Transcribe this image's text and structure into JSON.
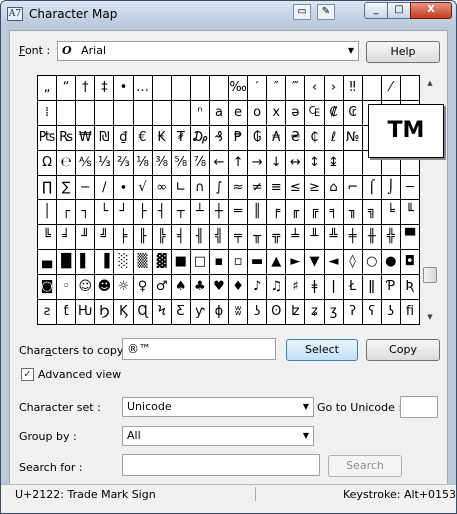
{
  "window": {
    "title": "Character Map",
    "app_icon_text": "A7",
    "icons": [
      "window-icon",
      "eraser-icon"
    ],
    "controls": {
      "minimize": "_",
      "maximize": "□",
      "close": "X"
    }
  },
  "font": {
    "label": "Font :",
    "value": "Arial",
    "icon_glyph": "O",
    "help_label": "Help"
  },
  "grid": {
    "rows": [
      [
        "„",
        "“",
        "†",
        "‡",
        "•",
        "…",
        "",
        "",
        "",
        "",
        "‰",
        "′",
        "″",
        "‴",
        "‹",
        "›",
        "‼",
        "",
        "⁄",
        ""
      ],
      [
        "⁞",
        "",
        "",
        "",
        "",
        "",
        "",
        "",
        "ⁿ",
        "a",
        "e",
        "o",
        "x",
        "ə",
        "₠",
        "₡",
        "₢",
        "₣",
        "₤",
        "₦"
      ],
      [
        "₧",
        "₨",
        "₩",
        "₪",
        "₫",
        "€",
        "₭",
        "₮",
        "₯",
        "₰",
        "₱",
        "₲",
        "₳",
        "₴",
        "₵",
        "ℓ",
        "№",
        "",
        "",
        ""
      ],
      [
        "Ω",
        "℮",
        "⅍",
        "⅓",
        "⅔",
        "⅛",
        "⅜",
        "⅝",
        "⅞",
        "←",
        "↑",
        "→",
        "↓",
        "↔",
        "↕",
        "↨",
        "",
        "",
        "",
        ""
      ],
      [
        "∏",
        "∑",
        "−",
        "∕",
        "∙",
        "√",
        "∞",
        "∟",
        "∩",
        "∫",
        "≈",
        "≠",
        "≡",
        "≤",
        "≥",
        "⌂",
        "⌐",
        "⌠",
        "⌡",
        "─"
      ],
      [
        "│",
        "┌",
        "┐",
        "└",
        "┘",
        "├",
        "┤",
        "┬",
        "┴",
        "┼",
        "═",
        "║",
        "╒",
        "╓",
        "╔",
        "╕",
        "╖",
        "╗",
        "╘",
        "╙"
      ],
      [
        "╚",
        "╛",
        "╜",
        "╝",
        "╞",
        "╟",
        "╠",
        "╡",
        "╢",
        "╣",
        "╤",
        "╥",
        "╦",
        "╧",
        "╨",
        "╩",
        "╪",
        "╫",
        "╬",
        "▀"
      ],
      [
        "▄",
        "█",
        "▌",
        "▐",
        "░",
        "▒",
        "▓",
        "■",
        "□",
        "▪",
        "▫",
        "▬",
        "▲",
        "►",
        "▼",
        "◄",
        "◊",
        "○",
        "●",
        "◘"
      ],
      [
        "◙",
        "◦",
        "☺",
        "☻",
        "☼",
        "♀",
        "♂",
        "♠",
        "♣",
        "♥",
        "♦",
        "♪",
        "♫",
        "♯",
        "ǂ",
        "ǀ",
        "Ł",
        "ǁ",
        "Ƥ",
        "Ʀ"
      ],
      [
        "ƨ",
        "ƭ",
        "Ƕ",
        "Ϧ",
        "Ϗ",
        "Ɋ",
        "Ϟ",
        "Ƹ",
        "ƴ",
        "ɸ",
        "ʬ",
        "ʖ",
        "ʘ",
        "ʫ",
        "ʑ",
        "ʒ",
        "ʔ",
        "ʕ",
        "ʖ",
        "ﬁ"
      ]
    ]
  },
  "zoom": {
    "glyph": "TM"
  },
  "copy": {
    "label": "Characters to copy",
    "value": "®™",
    "select_label": "Select",
    "copy_label": "Copy"
  },
  "advanced": {
    "label": "Advanced view",
    "checked": true
  },
  "character_set": {
    "label": "Character set :",
    "value": "Unicode"
  },
  "go_to_unicode": {
    "label": "Go to Unicode :",
    "value": ""
  },
  "group_by": {
    "label": "Group by :",
    "value": "All"
  },
  "search": {
    "label": "Search for :",
    "value": "",
    "button_label": "Search"
  },
  "status": {
    "left": "U+2122: Trade Mark Sign",
    "right": "Keystroke: Alt+0153"
  }
}
